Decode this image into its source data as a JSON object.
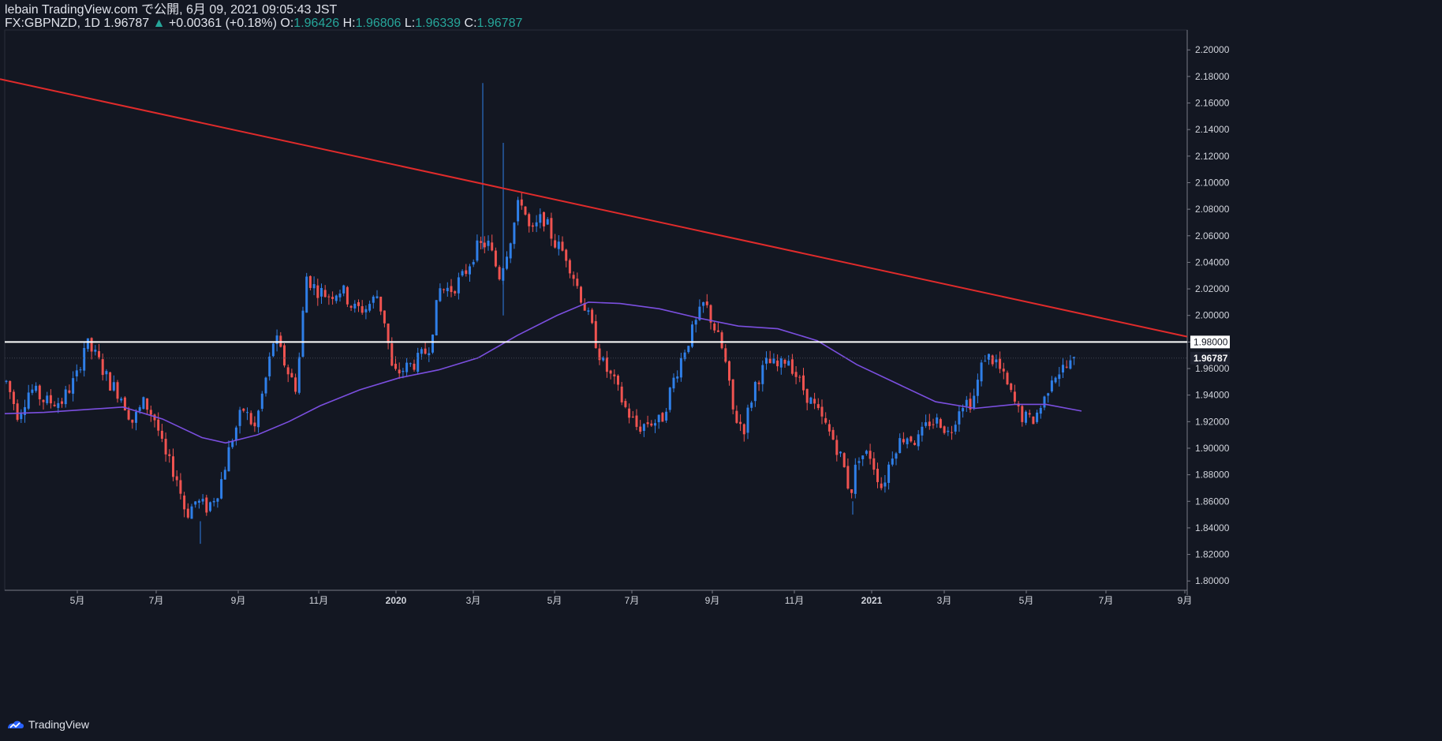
{
  "header": {
    "publish_line": "lebain TradingView.com で公開, 6月 09, 2021 09:05:43 JST",
    "symbol": "FX:GBPNZD, 1D",
    "last": "1.96787",
    "change_arrow": "▲",
    "change": "+0.00361 (+0.18%)",
    "o_label": "O:",
    "o_value": "1.96426",
    "h_label": "H:",
    "h_value": "1.96806",
    "l_label": "L:",
    "l_value": "1.96339",
    "c_label": "C:",
    "c_value": "1.96787"
  },
  "footer": {
    "brand": "TradingView"
  },
  "colors": {
    "background": "#131722",
    "up_candle": "#2f7fe8",
    "down_candle": "#ef5350",
    "trendline": "#e02b2b",
    "ma_line": "#7b4fe0",
    "horizontal_line": "#ffffff"
  },
  "chart_data": {
    "type": "candlestick",
    "symbol": "FX:GBPNZD",
    "timeframe": "1D",
    "x_tick_labels": [
      "5月",
      "7月",
      "9月",
      "11月",
      "2020",
      "3月",
      "5月",
      "7月",
      "9月",
      "11月",
      "2021",
      "3月",
      "5月",
      "7月",
      "9月"
    ],
    "y_tick_labels": [
      "2.20000",
      "2.18000",
      "2.16000",
      "2.14000",
      "2.12000",
      "2.10000",
      "2.08000",
      "2.06000",
      "2.04000",
      "2.02000",
      "2.00000",
      "1.98000",
      "1.96000",
      "1.94000",
      "1.92000",
      "1.90000",
      "1.88000",
      "1.86000",
      "1.84000",
      "1.82000",
      "1.80000"
    ],
    "ylim": [
      1.793,
      2.215
    ],
    "price_series": [
      {
        "x": 0,
        "y": 1.95
      },
      {
        "x": 15,
        "y": 1.925
      },
      {
        "x": 30,
        "y": 1.945
      },
      {
        "x": 50,
        "y": 1.935
      },
      {
        "x": 70,
        "y": 1.935
      },
      {
        "x": 90,
        "y": 1.955
      },
      {
        "x": 100,
        "y": 1.98
      },
      {
        "x": 115,
        "y": 1.968
      },
      {
        "x": 130,
        "y": 1.95
      },
      {
        "x": 145,
        "y": 1.94
      },
      {
        "x": 160,
        "y": 1.92
      },
      {
        "x": 175,
        "y": 1.935
      },
      {
        "x": 190,
        "y": 1.92
      },
      {
        "x": 200,
        "y": 1.895
      },
      {
        "x": 215,
        "y": 1.88
      },
      {
        "x": 228,
        "y": 1.85
      },
      {
        "x": 240,
        "y": 1.86
      },
      {
        "x": 255,
        "y": 1.855
      },
      {
        "x": 270,
        "y": 1.87
      },
      {
        "x": 285,
        "y": 1.905
      },
      {
        "x": 300,
        "y": 1.93
      },
      {
        "x": 315,
        "y": 1.915
      },
      {
        "x": 330,
        "y": 1.955
      },
      {
        "x": 340,
        "y": 1.985
      },
      {
        "x": 355,
        "y": 1.96
      },
      {
        "x": 368,
        "y": 1.945
      },
      {
        "x": 380,
        "y": 2.03
      },
      {
        "x": 392,
        "y": 2.02
      },
      {
        "x": 408,
        "y": 2.015
      },
      {
        "x": 425,
        "y": 2.02
      },
      {
        "x": 440,
        "y": 2.005
      },
      {
        "x": 455,
        "y": 2.005
      },
      {
        "x": 470,
        "y": 2.015
      },
      {
        "x": 480,
        "y": 1.995
      },
      {
        "x": 490,
        "y": 1.955
      },
      {
        "x": 505,
        "y": 1.96
      },
      {
        "x": 520,
        "y": 1.965
      },
      {
        "x": 535,
        "y": 1.975
      },
      {
        "x": 550,
        "y": 2.02
      },
      {
        "x": 565,
        "y": 2.02
      },
      {
        "x": 580,
        "y": 2.03
      },
      {
        "x": 595,
        "y": 2.05
      },
      {
        "x": 610,
        "y": 2.055
      },
      {
        "x": 625,
        "y": 2.03
      },
      {
        "x": 640,
        "y": 2.06
      },
      {
        "x": 652,
        "y": 2.09
      },
      {
        "x": 665,
        "y": 2.06
      },
      {
        "x": 680,
        "y": 2.075
      },
      {
        "x": 695,
        "y": 2.055
      },
      {
        "x": 710,
        "y": 2.045
      },
      {
        "x": 725,
        "y": 2.02
      },
      {
        "x": 740,
        "y": 1.995
      },
      {
        "x": 755,
        "y": 1.965
      },
      {
        "x": 770,
        "y": 1.95
      },
      {
        "x": 785,
        "y": 1.93
      },
      {
        "x": 800,
        "y": 1.915
      },
      {
        "x": 815,
        "y": 1.92
      },
      {
        "x": 830,
        "y": 1.92
      },
      {
        "x": 845,
        "y": 1.95
      },
      {
        "x": 860,
        "y": 1.975
      },
      {
        "x": 875,
        "y": 1.995
      },
      {
        "x": 885,
        "y": 2.01
      },
      {
        "x": 895,
        "y": 1.995
      },
      {
        "x": 910,
        "y": 1.97
      },
      {
        "x": 922,
        "y": 1.925
      },
      {
        "x": 935,
        "y": 1.915
      },
      {
        "x": 950,
        "y": 1.95
      },
      {
        "x": 965,
        "y": 1.965
      },
      {
        "x": 980,
        "y": 1.96
      },
      {
        "x": 990,
        "y": 1.97
      },
      {
        "x": 1005,
        "y": 1.95
      },
      {
        "x": 1020,
        "y": 1.935
      },
      {
        "x": 1035,
        "y": 1.92
      },
      {
        "x": 1050,
        "y": 1.905
      },
      {
        "x": 1060,
        "y": 1.89
      },
      {
        "x": 1070,
        "y": 1.865
      },
      {
        "x": 1080,
        "y": 1.895
      },
      {
        "x": 1095,
        "y": 1.895
      },
      {
        "x": 1110,
        "y": 1.87
      },
      {
        "x": 1125,
        "y": 1.9
      },
      {
        "x": 1140,
        "y": 1.91
      },
      {
        "x": 1155,
        "y": 1.905
      },
      {
        "x": 1170,
        "y": 1.92
      },
      {
        "x": 1185,
        "y": 1.92
      },
      {
        "x": 1195,
        "y": 1.91
      },
      {
        "x": 1210,
        "y": 1.935
      },
      {
        "x": 1225,
        "y": 1.935
      },
      {
        "x": 1240,
        "y": 1.97
      },
      {
        "x": 1255,
        "y": 1.965
      },
      {
        "x": 1270,
        "y": 1.945
      },
      {
        "x": 1285,
        "y": 1.925
      },
      {
        "x": 1300,
        "y": 1.92
      },
      {
        "x": 1315,
        "y": 1.935
      },
      {
        "x": 1325,
        "y": 1.955
      },
      {
        "x": 1340,
        "y": 1.96
      },
      {
        "x": 1355,
        "y": 1.965
      }
    ],
    "moving_average": [
      {
        "x": 0,
        "y": 1.926
      },
      {
        "x": 50,
        "y": 1.927
      },
      {
        "x": 100,
        "y": 1.929
      },
      {
        "x": 150,
        "y": 1.931
      },
      {
        "x": 200,
        "y": 1.922
      },
      {
        "x": 250,
        "y": 1.908
      },
      {
        "x": 280,
        "y": 1.904
      },
      {
        "x": 320,
        "y": 1.91
      },
      {
        "x": 360,
        "y": 1.92
      },
      {
        "x": 400,
        "y": 1.932
      },
      {
        "x": 450,
        "y": 1.944
      },
      {
        "x": 500,
        "y": 1.953
      },
      {
        "x": 550,
        "y": 1.959
      },
      {
        "x": 600,
        "y": 1.968
      },
      {
        "x": 650,
        "y": 1.985
      },
      {
        "x": 700,
        "y": 2.0
      },
      {
        "x": 740,
        "y": 2.01
      },
      {
        "x": 780,
        "y": 2.009
      },
      {
        "x": 830,
        "y": 2.005
      },
      {
        "x": 880,
        "y": 1.998
      },
      {
        "x": 930,
        "y": 1.992
      },
      {
        "x": 980,
        "y": 1.99
      },
      {
        "x": 1030,
        "y": 1.981
      },
      {
        "x": 1080,
        "y": 1.963
      },
      {
        "x": 1130,
        "y": 1.949
      },
      {
        "x": 1180,
        "y": 1.935
      },
      {
        "x": 1230,
        "y": 1.93
      },
      {
        "x": 1280,
        "y": 1.933
      },
      {
        "x": 1320,
        "y": 1.933
      },
      {
        "x": 1365,
        "y": 1.928
      }
    ],
    "trendline": [
      {
        "x": 0,
        "y": 2.178
      },
      {
        "x": 1505,
        "y": 1.984
      }
    ],
    "horizontal_level": {
      "y": 1.98,
      "label": "1.98000"
    },
    "last_price_label": "1.96787",
    "last_price": 1.96787
  }
}
